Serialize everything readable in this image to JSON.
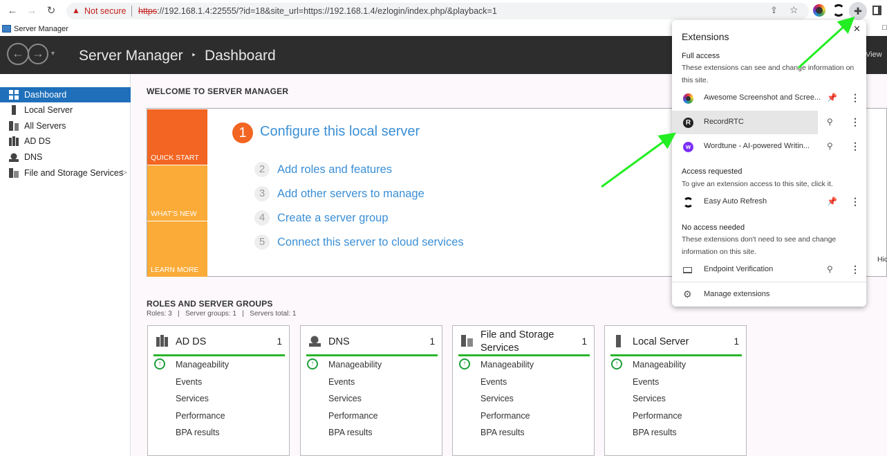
{
  "browser": {
    "security_label": "Not secure",
    "url_scheme": "https",
    "url_rest": "://192.168.1.4:22555/?id=18&site_url=https://192.168.1.4/ezlogin/index.php/&playback=1"
  },
  "window": {
    "title": "Server Manager"
  },
  "header": {
    "app": "Server Manager",
    "separator": "‣",
    "page": "Dashboard",
    "right_fragment": "View"
  },
  "sidebar": {
    "items": [
      {
        "label": "Dashboard",
        "icon": "dashboard-icon"
      },
      {
        "label": "Local Server",
        "icon": "server-icon"
      },
      {
        "label": "All Servers",
        "icon": "servers-icon"
      },
      {
        "label": "AD DS",
        "icon": "adds-icon"
      },
      {
        "label": "DNS",
        "icon": "dns-icon"
      },
      {
        "label": "File and Storage Services",
        "icon": "storage-icon"
      }
    ],
    "expand_arrow": "▷"
  },
  "welcome": {
    "heading": "WELCOME TO SERVER MANAGER",
    "tiles": [
      "QUICK START",
      "WHAT'S NEW",
      "LEARN MORE"
    ],
    "main_step": {
      "num": "1",
      "label": "Configure this local server"
    },
    "steps": [
      {
        "num": "2",
        "label": "Add roles and features"
      },
      {
        "num": "3",
        "label": "Add other servers to manage"
      },
      {
        "num": "4",
        "label": "Create a server group"
      },
      {
        "num": "5",
        "label": "Connect this server to cloud services"
      }
    ],
    "hide_fragment": "Hic"
  },
  "roles": {
    "heading": "ROLES AND SERVER GROUPS",
    "summary": "Roles: 3   |   Server groups: 1   |   Servers total: 1",
    "cards": [
      {
        "title": "AD DS",
        "count": "1",
        "icon": "adds-icon"
      },
      {
        "title": "DNS",
        "count": "1",
        "icon": "dns-icon"
      },
      {
        "title": "File and Storage Services",
        "count": "1",
        "icon": "storage-icon"
      },
      {
        "title": "Local Server",
        "count": "1",
        "icon": "server-icon"
      }
    ],
    "rows": [
      "Manageability",
      "Events",
      "Services",
      "Performance",
      "BPA results"
    ],
    "status_color": "#2bb52b"
  },
  "extensions": {
    "title": "Extensions",
    "close": "✕",
    "full_access": {
      "heading": "Full access",
      "desc_line1": "These extensions can see and change information on",
      "desc_line2": "this site."
    },
    "items_full": [
      {
        "name": "Awesome Screenshot and Scree...",
        "pinned": true
      },
      {
        "name": "RecordRTC",
        "pinned": false
      },
      {
        "name": "Wordtune - AI-powered Writin...",
        "pinned": false
      }
    ],
    "access_requested": {
      "heading": "Access requested",
      "desc": "To give an extension access to this site, click it."
    },
    "items_requested": [
      {
        "name": "Easy Auto Refresh",
        "pinned": true
      }
    ],
    "no_access": {
      "heading": "No access needed",
      "desc_line1": "These extensions don't need to see and change",
      "desc_line2": "information on this site."
    },
    "items_none": [
      {
        "name": "Endpoint Verification",
        "pinned": false
      }
    ],
    "manage": "Manage extensions",
    "accent": "#1a73e8"
  },
  "annotations": {
    "arrow_color": "#22ee22"
  }
}
